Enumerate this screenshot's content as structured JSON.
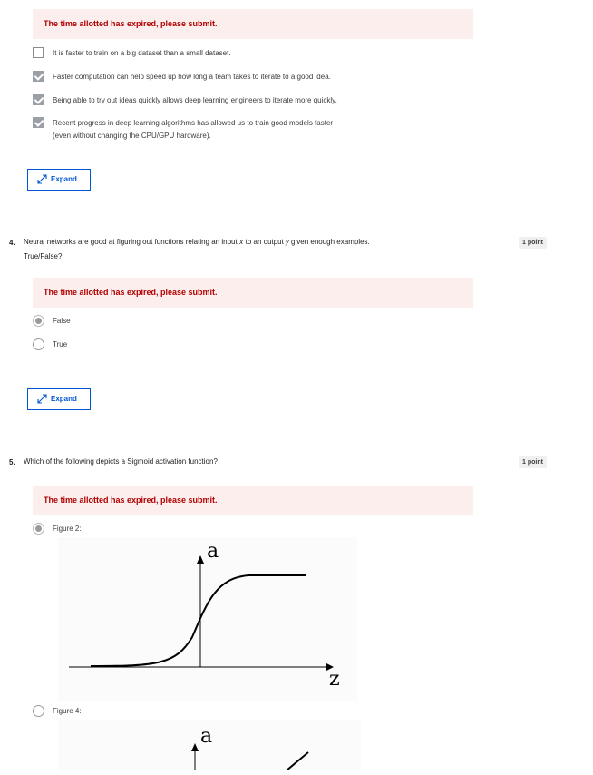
{
  "q3": {
    "banner": "The time allotted has expired, please submit.",
    "options": [
      {
        "label": "It is faster to train on a big dataset than a small dataset.",
        "checked": false
      },
      {
        "label": "Faster computation can help speed up how long a team takes to iterate to a good idea.",
        "checked": true
      },
      {
        "label": "Being able to try out ideas quickly allows deep learning engineers to iterate more quickly.",
        "checked": true
      },
      {
        "label_line1": "Recent progress in deep learning algorithms has allowed us to train good models faster",
        "label_line2": "(even without changing the CPU/GPU hardware).",
        "checked": true
      }
    ],
    "expand_label": "Expand"
  },
  "q4": {
    "number": "4.",
    "text_line1": "Neural networks are good at figuring out functions relating an input 𝑥 to an output 𝑦 given enough examples.",
    "text_line2": "True/False?",
    "points": "1 point",
    "banner": "The time allotted has expired, please submit.",
    "options": [
      {
        "label": "False",
        "selected": true
      },
      {
        "label": "True",
        "selected": false
      }
    ],
    "expand_label": "Expand"
  },
  "q5": {
    "number": "5.",
    "text": "Which of the following depicts a Sigmoid activation function?",
    "points": "1 point",
    "banner": "The time allotted has expired, please submit.",
    "options": [
      {
        "label": "Figure 2:",
        "selected": true,
        "figure": {
          "y_axis": "a",
          "x_axis": "z",
          "curve": "sigmoid"
        }
      },
      {
        "label": "Figure 4:",
        "selected": false,
        "figure": {
          "y_axis": "a",
          "curve": "linear"
        }
      }
    ]
  },
  "colors": {
    "banner_bg": "#fdeeee",
    "banner_text": "#b00000",
    "accent": "#0056d2",
    "checked": "#9aa0a6"
  },
  "icons": {
    "expand": "expand-arrows-icon",
    "checkbox": "checkbox-icon",
    "radio": "radio-icon"
  }
}
